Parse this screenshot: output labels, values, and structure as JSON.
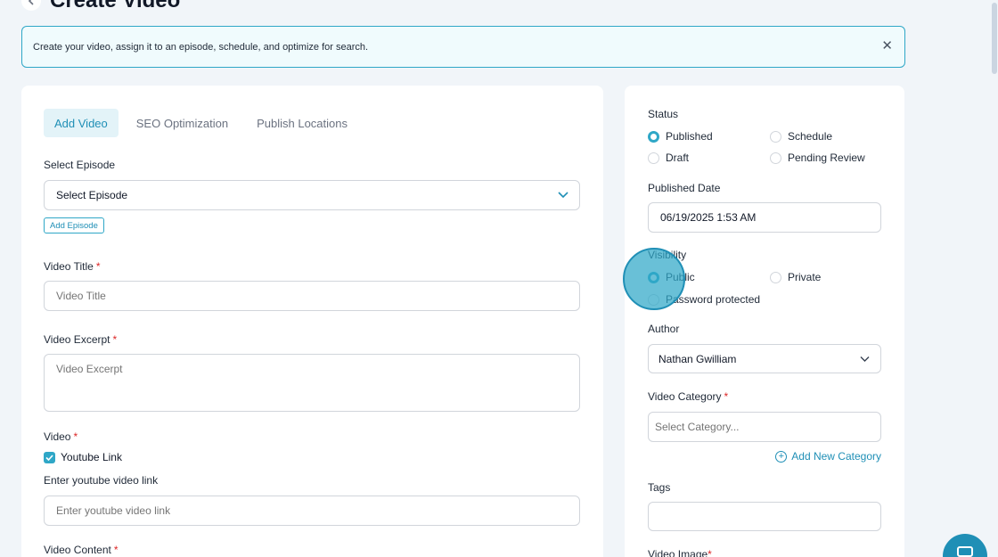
{
  "header": {
    "title": "Create Video",
    "back_icon": "chevron-left-icon"
  },
  "banner": {
    "text": "Create your video, assign it to an episode, schedule, and optimize for search.",
    "close_icon": "close-icon",
    "close_glyph": "✕"
  },
  "tabs": [
    {
      "label": "Add Video",
      "active": true
    },
    {
      "label": "SEO Optimization",
      "active": false
    },
    {
      "label": "Publish Locations",
      "active": false
    }
  ],
  "form": {
    "episode_label": "Select Episode",
    "episode_value": "Select Episode",
    "add_episode_label": "Add Episode",
    "title_label": "Video Title",
    "title_placeholder": "Video Title",
    "excerpt_label": "Video Excerpt",
    "excerpt_placeholder": "Video Excerpt",
    "video_label": "Video",
    "youtube_checkbox_label": "Youtube Link",
    "youtube_checked": true,
    "youtube_field_label": "Enter youtube video link",
    "youtube_placeholder": "Enter youtube video link",
    "content_label": "Video Content",
    "required_mark": "*"
  },
  "sidebar": {
    "status_label": "Status",
    "status_options": [
      "Published",
      "Schedule",
      "Draft",
      "Pending Review"
    ],
    "status_selected": "Published",
    "published_date_label": "Published Date",
    "published_date_value": "06/19/2025 1:53 AM",
    "visibility_label": "Visibility",
    "visibility_options": [
      "Public",
      "Private",
      "Password protected"
    ],
    "visibility_selected": "Public",
    "author_label": "Author",
    "author_value": "Nathan Gwilliam",
    "category_label": "Video Category",
    "category_placeholder": "Select Category...",
    "add_category_label": "Add New Category",
    "tags_label": "Tags",
    "image_label": "Video Image"
  },
  "colors": {
    "accent": "#2fa7c7",
    "accent_dark": "#1f8fb6",
    "required": "#dc2626",
    "background": "#f1f5f9"
  },
  "widgets": {
    "chat_icon": "chat-icon"
  }
}
